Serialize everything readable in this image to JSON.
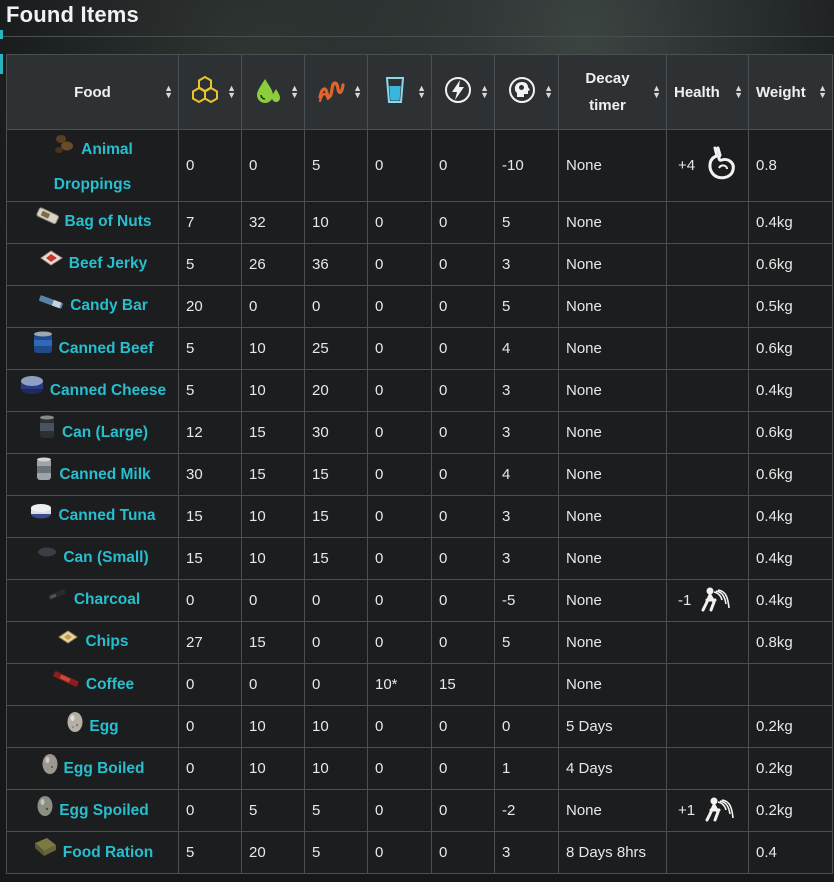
{
  "title": "Found Items",
  "header": {
    "food": "Food",
    "decay": [
      "Decay",
      "timer"
    ],
    "health": "Health",
    "weight": "Weight",
    "stat_icons": [
      "energy-hexagons-icon",
      "water-drops-icon",
      "stomach-worm-icon",
      "glass-of-water-icon",
      "lightning-bolt-icon",
      "head-brain-icon"
    ]
  },
  "colors": {
    "accent": "#27bfcf",
    "background": "#1c1d1e",
    "header": "#2e3134",
    "border": "#4a4f53"
  },
  "rows": [
    {
      "name": "Animal Droppings",
      "icon": "droppings-icon",
      "c1": "0",
      "c2": "0",
      "c3": "5",
      "c4": "0",
      "c5": "0",
      "c6": "-10",
      "decay": "None",
      "health": "+4",
      "health_icon": "stomach-icon",
      "weight": "0.8"
    },
    {
      "name": "Bag of Nuts",
      "icon": "nuts-bag-icon",
      "c1": "7",
      "c2": "32",
      "c3": "10",
      "c4": "0",
      "c5": "0",
      "c6": "5",
      "decay": "None",
      "health": "",
      "health_icon": "",
      "weight": "0.4kg"
    },
    {
      "name": "Beef Jerky",
      "icon": "jerky-icon",
      "c1": "5",
      "c2": "26",
      "c3": "36",
      "c4": "0",
      "c5": "0",
      "c6": "3",
      "decay": "None",
      "health": "",
      "health_icon": "",
      "weight": "0.6kg"
    },
    {
      "name": "Candy Bar",
      "icon": "candy-bar-icon",
      "c1": "20",
      "c2": "0",
      "c3": "0",
      "c4": "0",
      "c5": "0",
      "c6": "5",
      "decay": "None",
      "health": "",
      "health_icon": "",
      "weight": "0.5kg"
    },
    {
      "name": "Canned Beef",
      "icon": "can-blue-icon",
      "c1": "5",
      "c2": "10",
      "c3": "25",
      "c4": "0",
      "c5": "0",
      "c6": "4",
      "decay": "None",
      "health": "",
      "health_icon": "",
      "weight": "0.6kg"
    },
    {
      "name": "Canned Cheese",
      "icon": "can-flat-icon",
      "c1": "5",
      "c2": "10",
      "c3": "20",
      "c4": "0",
      "c5": "0",
      "c6": "3",
      "decay": "None",
      "health": "",
      "health_icon": "",
      "weight": "0.4kg"
    },
    {
      "name": "Can (Large)",
      "icon": "can-dark-icon",
      "c1": "12",
      "c2": "15",
      "c3": "30",
      "c4": "0",
      "c5": "0",
      "c6": "3",
      "decay": "None",
      "health": "",
      "health_icon": "",
      "weight": "0.6kg"
    },
    {
      "name": "Canned Milk",
      "icon": "can-silver-icon",
      "c1": "30",
      "c2": "15",
      "c3": "15",
      "c4": "0",
      "c5": "0",
      "c6": "4",
      "decay": "None",
      "health": "",
      "health_icon": "",
      "weight": "0.6kg"
    },
    {
      "name": "Canned Tuna",
      "icon": "tuna-can-icon",
      "c1": "15",
      "c2": "10",
      "c3": "15",
      "c4": "0",
      "c5": "0",
      "c6": "3",
      "decay": "None",
      "health": "",
      "health_icon": "",
      "weight": "0.4kg"
    },
    {
      "name": "Can (Small)",
      "icon": "small-can-icon",
      "c1": "15",
      "c2": "10",
      "c3": "15",
      "c4": "0",
      "c5": "0",
      "c6": "3",
      "decay": "None",
      "health": "",
      "health_icon": "",
      "weight": "0.4kg"
    },
    {
      "name": "Charcoal",
      "icon": "charcoal-icon",
      "c1": "0",
      "c2": "0",
      "c3": "0",
      "c4": "0",
      "c5": "0",
      "c6": "-5",
      "decay": "None",
      "health": "-1",
      "health_icon": "vomit-icon",
      "weight": "0.4kg"
    },
    {
      "name": "Chips",
      "icon": "chips-icon",
      "c1": "27",
      "c2": "15",
      "c3": "0",
      "c4": "0",
      "c5": "0",
      "c6": "5",
      "decay": "None",
      "health": "",
      "health_icon": "",
      "weight": "0.8kg"
    },
    {
      "name": "Coffee",
      "icon": "coffee-icon",
      "c1": "0",
      "c2": "0",
      "c3": "0",
      "c4": "10*",
      "c5": "15",
      "c6": "",
      "decay": "None",
      "health": "",
      "health_icon": "",
      "weight": ""
    },
    {
      "name": "Egg",
      "icon": "egg-icon",
      "c1": "0",
      "c2": "10",
      "c3": "10",
      "c4": "0",
      "c5": "0",
      "c6": "0",
      "decay": "5 Days",
      "health": "",
      "health_icon": "",
      "weight": "0.2kg"
    },
    {
      "name": "Egg Boiled",
      "icon": "egg-boiled-icon",
      "c1": "0",
      "c2": "10",
      "c3": "10",
      "c4": "0",
      "c5": "0",
      "c6": "1",
      "decay": "4 Days",
      "health": "",
      "health_icon": "",
      "weight": "0.2kg"
    },
    {
      "name": "Egg Spoiled",
      "icon": "egg-spoiled-icon",
      "c1": "0",
      "c2": "5",
      "c3": "5",
      "c4": "0",
      "c5": "0",
      "c6": "-2",
      "decay": "None",
      "health": "+1",
      "health_icon": "vomit-icon",
      "weight": "0.2kg"
    },
    {
      "name": "Food Ration",
      "icon": "ration-icon",
      "c1": "5",
      "c2": "20",
      "c3": "5",
      "c4": "0",
      "c5": "0",
      "c6": "3",
      "decay": "8 Days 8hrs",
      "health": "",
      "health_icon": "",
      "weight": "0.4"
    }
  ]
}
